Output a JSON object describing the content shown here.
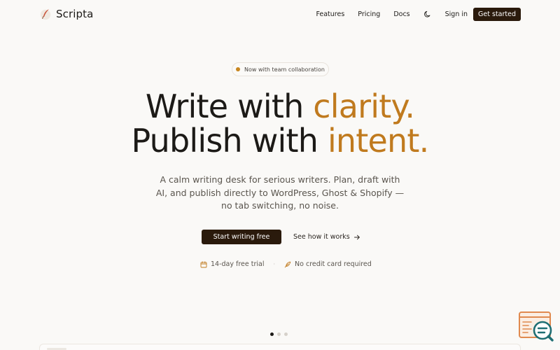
{
  "brand": {
    "name": "Scripta",
    "logo_icon": "quill-icon"
  },
  "nav": {
    "features": "Features",
    "pricing": "Pricing",
    "docs": "Docs",
    "theme_icon": "moon-icon",
    "signin": "Sign in",
    "get_started": "Get started"
  },
  "hero": {
    "badge": "Now with team collaboration",
    "headline": {
      "line1_prefix": "Write with ",
      "line1_accent": "clarity.",
      "line2_prefix": "Publish with ",
      "line2_accent": "intent."
    },
    "subtitle": "A calm writing desk for serious writers. Plan, draft with AI, and publish directly to WordPress, Ghost & Shopify — no tab switching, no noise.",
    "primary_cta": "Start writing free",
    "secondary_cta": "See how it works",
    "perks": [
      {
        "icon": "calendar-icon",
        "label": "14-day free trial"
      },
      {
        "icon": "feather-icon",
        "label": "No credit card required"
      }
    ],
    "perk_separator": "·"
  },
  "carousel": {
    "total": 3,
    "active_index": 0
  },
  "colors": {
    "accent": "#c07a1e",
    "dark": "#2a1a0c",
    "background": "#faf9f7",
    "text": "#1c1a17",
    "muted": "#5a554e",
    "widget_orange": "#e08a4f",
    "widget_teal": "#1f6f74"
  },
  "widget": {
    "icon": "chat-search-icon"
  }
}
